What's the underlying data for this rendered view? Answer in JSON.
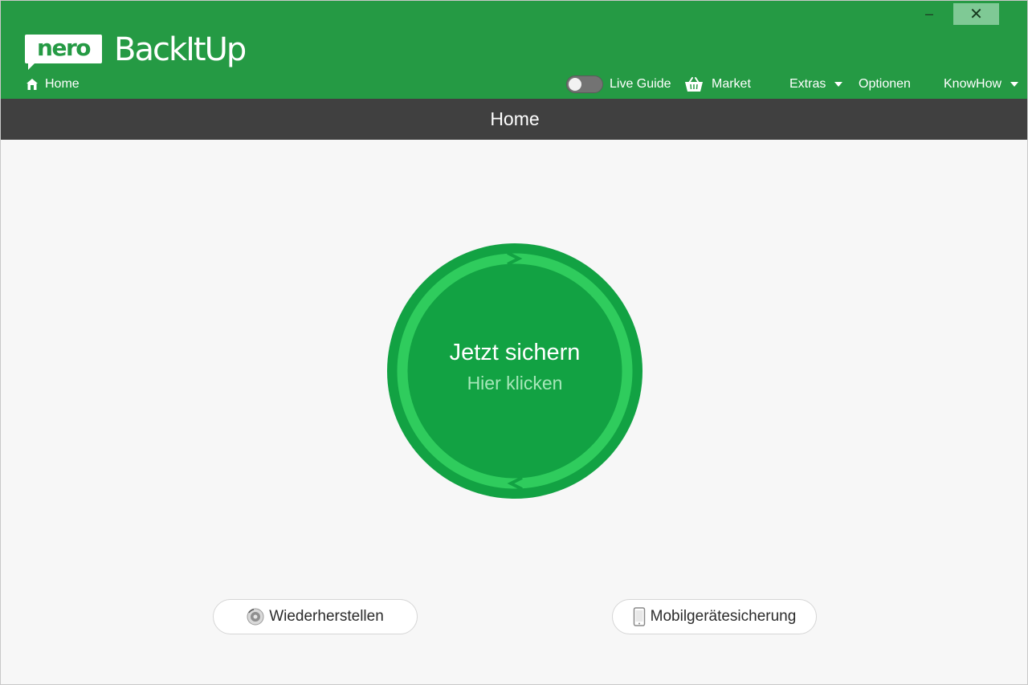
{
  "window": {
    "minimize_glyph": "–",
    "close_glyph": "✕"
  },
  "header": {
    "logo_text": "nero",
    "product_name": "BackItUp",
    "home_label": "Home",
    "menu": {
      "live_guide": "Live Guide",
      "market": "Market",
      "extras": "Extras",
      "optionen": "Optionen",
      "knowhow": "KnowHow"
    },
    "live_guide_toggle_on": false
  },
  "title_bar": {
    "title": "Home"
  },
  "main": {
    "backup_button": {
      "title": "Jetzt sichern",
      "subtitle": "Hier klicken"
    },
    "restore_button": "Wiederherstellen",
    "mobile_button": "Mobilgerätesicherung"
  },
  "colors": {
    "header_green": "#259a44",
    "title_bar_gray": "#404040",
    "circle_outer": "#12a243",
    "circle_ring": "#2fcc5d",
    "background": "#f7f7f7"
  },
  "icons": {
    "home": "house-icon",
    "market": "basket-icon",
    "dropdown": "caret-down-icon",
    "restore": "restore-disc-icon",
    "mobile": "smartphone-icon"
  }
}
